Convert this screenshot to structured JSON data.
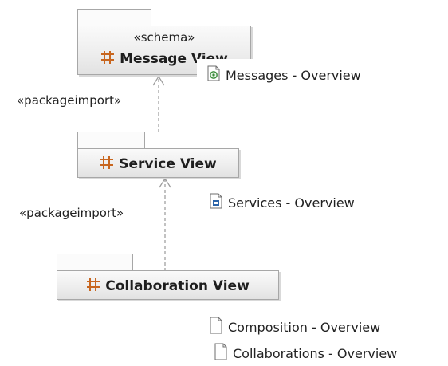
{
  "packages": {
    "message_view": {
      "stereotype": "«schema»",
      "name": "Message View"
    },
    "service_view": {
      "name": "Service View"
    },
    "collaboration_view": {
      "name": "Collaboration View"
    }
  },
  "relations": {
    "import_1": "«packageimport»",
    "import_2": "«packageimport»"
  },
  "documents": {
    "messages_overview": {
      "label": "Messages - Overview",
      "icon": "schema-document-icon"
    },
    "services_overview": {
      "label": "Services - Overview",
      "icon": "service-document-icon"
    },
    "composition_overview": {
      "label": "Composition - Overview",
      "icon": "document-icon"
    },
    "collaborations_overview": {
      "label": "Collaborations - Overview",
      "icon": "document-icon"
    }
  },
  "colors": {
    "package_icon": "#c8661f",
    "package_border": "#a7a7a7",
    "arrow": "#9a9a9a",
    "schema_icon": "#3a8a3a",
    "service_icon": "#2a63a8"
  }
}
